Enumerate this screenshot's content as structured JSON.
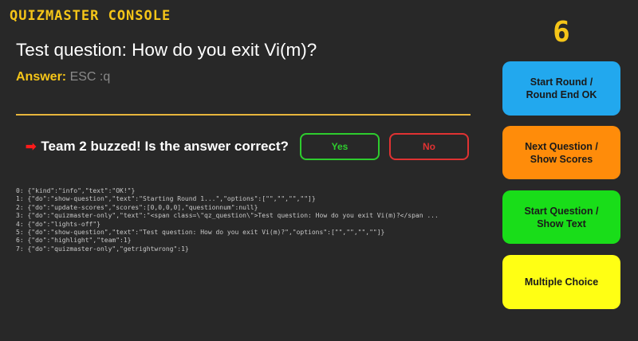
{
  "header": {
    "title": "QUIZMASTER CONSOLE",
    "counter": "6"
  },
  "question": {
    "text": "Test question: How do you exit Vi(m)?",
    "answer_label": "Answer:",
    "answer_value": "ESC :q"
  },
  "buzz": {
    "message": "Team 2 buzzed! Is the answer correct?",
    "arrow_icon": "right-arrow-icon",
    "yes_label": "Yes",
    "no_label": "No"
  },
  "log": [
    "0: {\"kind\":\"info\",\"text\":\"OK!\"}",
    "1: {\"do\":\"show-question\",\"text\":\"Starting Round 1...\",\"options\":[\"\",\"\",\"\",\"\"]}",
    "2: {\"do\":\"update-scores\",\"scores\":[0,0,0,0],\"questionnum\":null}",
    "3: {\"do\":\"quizmaster-only\",\"text\":\"<span class=\\\"qz_question\\\">Test question: How do you exit Vi(m)?</span ...",
    "4: {\"do\":\"lights-off\"}",
    "5: {\"do\":\"show-question\",\"text\":\"Test question: How do you exit Vi(m)?\",\"options\":[\"\",\"\",\"\",\"\"]}",
    "6: {\"do\":\"highlight\",\"team\":1}",
    "7: {\"do\":\"quizmaster-only\",\"getrightwrong\":1}"
  ],
  "controls": {
    "start_round": "Start Round /\nRound End OK",
    "next_question": "Next Question /\nShow Scores",
    "start_question": "Start Question /\nShow Text",
    "multiple_choice": "Multiple Choice"
  },
  "colors": {
    "accent": "#f5c518",
    "background": "#282828",
    "yes": "#2ecc2e",
    "no": "#e03232",
    "start_round": "#22a8ee",
    "next_question": "#ff8c0a",
    "start_question": "#19dd19",
    "multiple_choice": "#ffff14"
  }
}
